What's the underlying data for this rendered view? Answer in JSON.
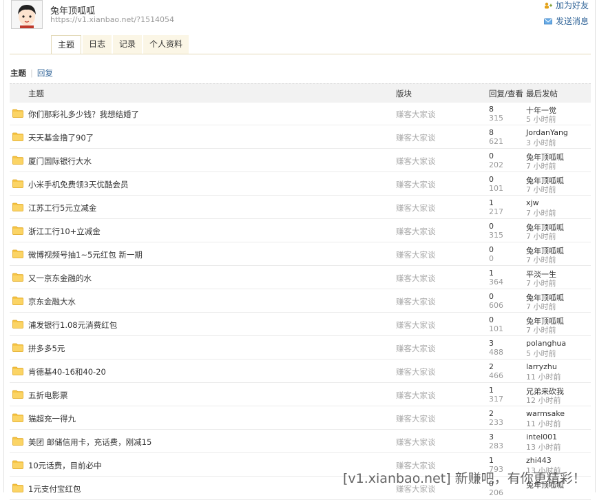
{
  "profile": {
    "name": "兔年顶呱呱",
    "url": "https://v1.xianbao.net/?1514054",
    "add_friend": "加为好友",
    "send_message": "发送消息"
  },
  "tabs": [
    {
      "label": "主题",
      "active": true
    },
    {
      "label": "日志",
      "active": false
    },
    {
      "label": "记录",
      "active": false
    },
    {
      "label": "个人资料",
      "active": false
    }
  ],
  "subnav": {
    "topics": "主题",
    "replies": "回复"
  },
  "table": {
    "headers": {
      "title": "主题",
      "forum": "版块",
      "stats": "回复/查看",
      "last_post": "最后发帖"
    },
    "rows": [
      {
        "title": "你们那彩礼多少钱？我想结婚了",
        "forum": "赚客大家谈",
        "replies": "8",
        "views": "315",
        "last_user": "十年一觉",
        "last_time": "5 小时前"
      },
      {
        "title": "天天基金撸了90了",
        "forum": "赚客大家谈",
        "replies": "8",
        "views": "621",
        "last_user": "JordanYang",
        "last_time": "3 小时前"
      },
      {
        "title": "厦门国际银行大水",
        "forum": "赚客大家谈",
        "replies": "0",
        "views": "202",
        "last_user": "兔年顶呱呱",
        "last_time": "7 小时前"
      },
      {
        "title": "小米手机免费领3天优酷会员",
        "forum": "赚客大家谈",
        "replies": "0",
        "views": "101",
        "last_user": "兔年顶呱呱",
        "last_time": "7 小时前"
      },
      {
        "title": "江苏工行5元立减金",
        "forum": "赚客大家谈",
        "replies": "1",
        "views": "217",
        "last_user": "xjw",
        "last_time": "7 小时前"
      },
      {
        "title": "浙江工行10+立减金",
        "forum": "赚客大家谈",
        "replies": "0",
        "views": "315",
        "last_user": "兔年顶呱呱",
        "last_time": "7 小时前"
      },
      {
        "title": "微博视频号抽1~5元红包 新一期",
        "forum": "赚客大家谈",
        "replies": "0",
        "views": "0",
        "last_user": "兔年顶呱呱",
        "last_time": "7 小时前"
      },
      {
        "title": "又一京东金融的水",
        "forum": "赚客大家谈",
        "replies": "1",
        "views": "364",
        "last_user": "平淡一生",
        "last_time": "7 小时前"
      },
      {
        "title": "京东金融大水",
        "forum": "赚客大家谈",
        "replies": "0",
        "views": "606",
        "last_user": "兔年顶呱呱",
        "last_time": "7 小时前"
      },
      {
        "title": "浦发银行1.08元消费红包",
        "forum": "赚客大家谈",
        "replies": "0",
        "views": "101",
        "last_user": "兔年顶呱呱",
        "last_time": "7 小时前"
      },
      {
        "title": "拼多多5元",
        "forum": "赚客大家谈",
        "replies": "3",
        "views": "488",
        "last_user": "polanghua",
        "last_time": "5 小时前"
      },
      {
        "title": "肯德基40-16和40-20",
        "forum": "赚客大家谈",
        "replies": "2",
        "views": "466",
        "last_user": "larryzhu",
        "last_time": "11 小时前"
      },
      {
        "title": "五折电影票",
        "forum": "赚客大家谈",
        "replies": "1",
        "views": "317",
        "last_user": "兄弟来砍我",
        "last_time": "12 小时前"
      },
      {
        "title": "猫超充一得九",
        "forum": "赚客大家谈",
        "replies": "2",
        "views": "233",
        "last_user": "warmsake",
        "last_time": "11 小时前"
      },
      {
        "title": "美团 邮储信用卡，充话费，刚减15",
        "forum": "赚客大家谈",
        "replies": "3",
        "views": "283",
        "last_user": "intel001",
        "last_time": "13 小时前"
      },
      {
        "title": "10元话费，目前必中",
        "forum": "赚客大家谈",
        "replies": "1",
        "views": "793",
        "last_user": "zhi443",
        "last_time": "13 小时前"
      },
      {
        "title": "1元支付宝红包",
        "forum": "赚客大家谈",
        "replies": "0",
        "views": "206",
        "last_user": "兔年顶呱呱",
        "last_time": ""
      }
    ]
  },
  "watermark": "[v1.xianbao.net] 新赚吧，有你更精彩！"
}
